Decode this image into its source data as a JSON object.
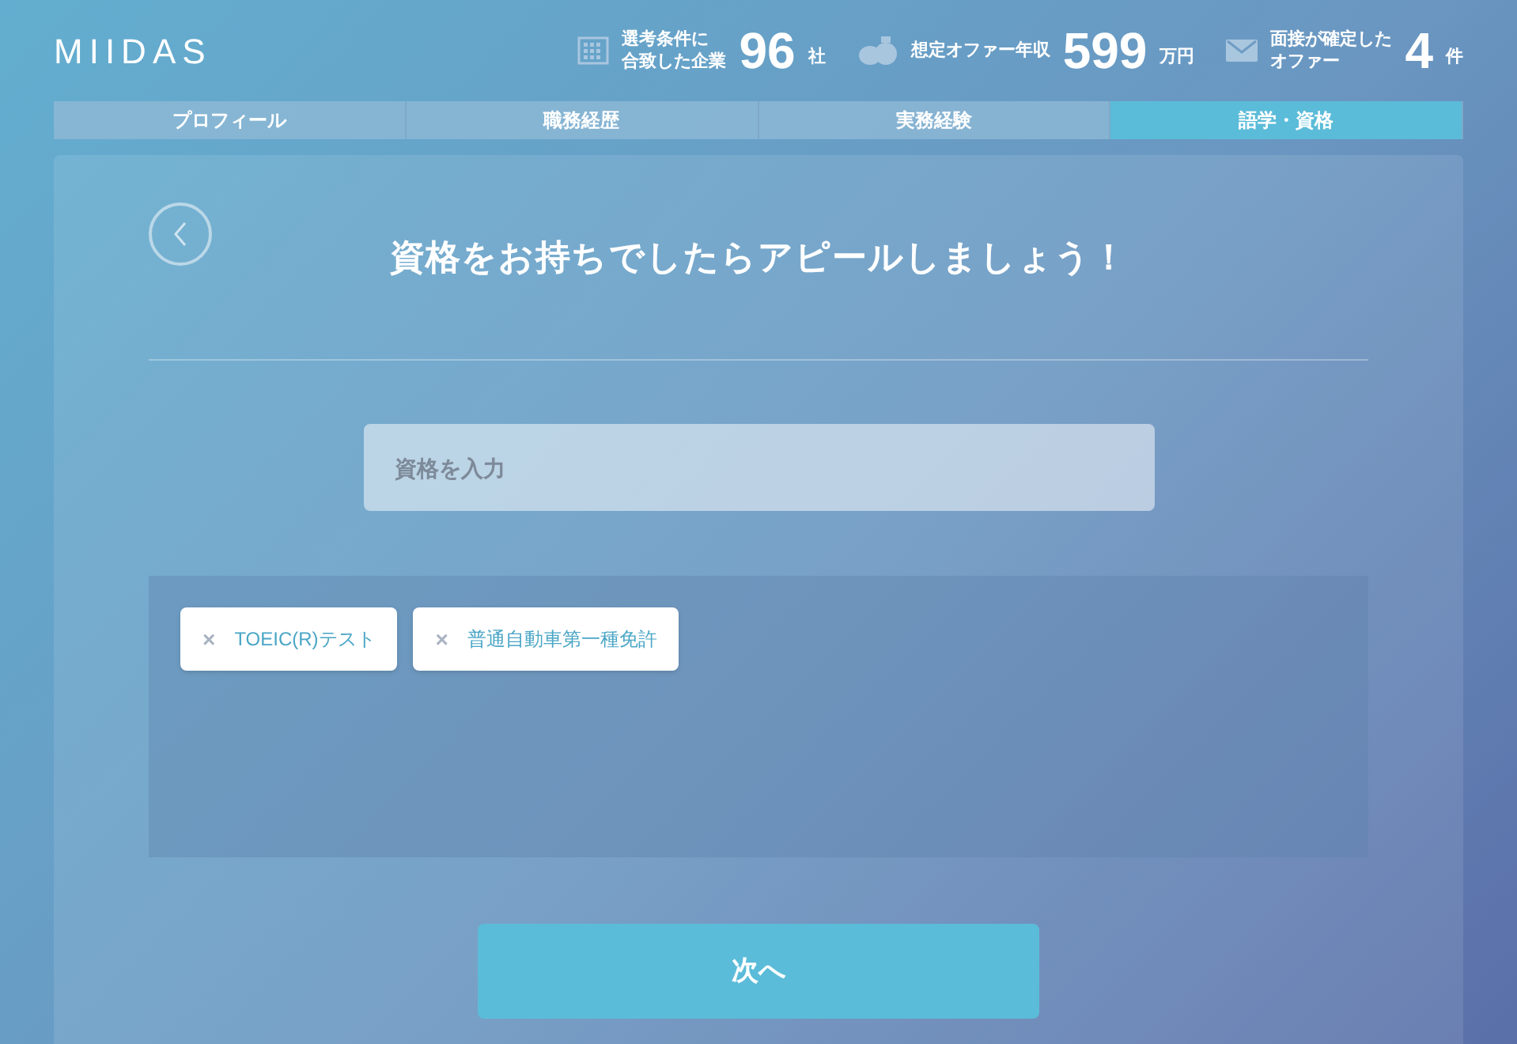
{
  "header": {
    "logo": "MIIDAS",
    "stats": [
      {
        "kind": "building",
        "label_lines": [
          "選考条件に",
          "合致した企業"
        ],
        "value": "96",
        "unit": "社"
      },
      {
        "kind": "money",
        "label_lines": [
          "想定オファー年収"
        ],
        "value": "599",
        "unit": "万円"
      },
      {
        "kind": "mail",
        "label_lines": [
          "面接が確定した",
          "オファー"
        ],
        "value": "4",
        "unit": "件"
      }
    ]
  },
  "steps": [
    {
      "label": "プロフィール",
      "selected": false
    },
    {
      "label": "職務経歴",
      "selected": false
    },
    {
      "label": "実務経験",
      "selected": false
    },
    {
      "label": "語学・資格",
      "selected": true
    }
  ],
  "card": {
    "title": "資格をお持ちでしたらアピールしましょう！",
    "input": {
      "placeholder": "資格を入力"
    },
    "tags": [
      {
        "remove": "×",
        "label": "TOEIC(R)テスト"
      },
      {
        "remove": "×",
        "label": "普通自動車第一種免許"
      }
    ],
    "next_button": "次へ"
  }
}
